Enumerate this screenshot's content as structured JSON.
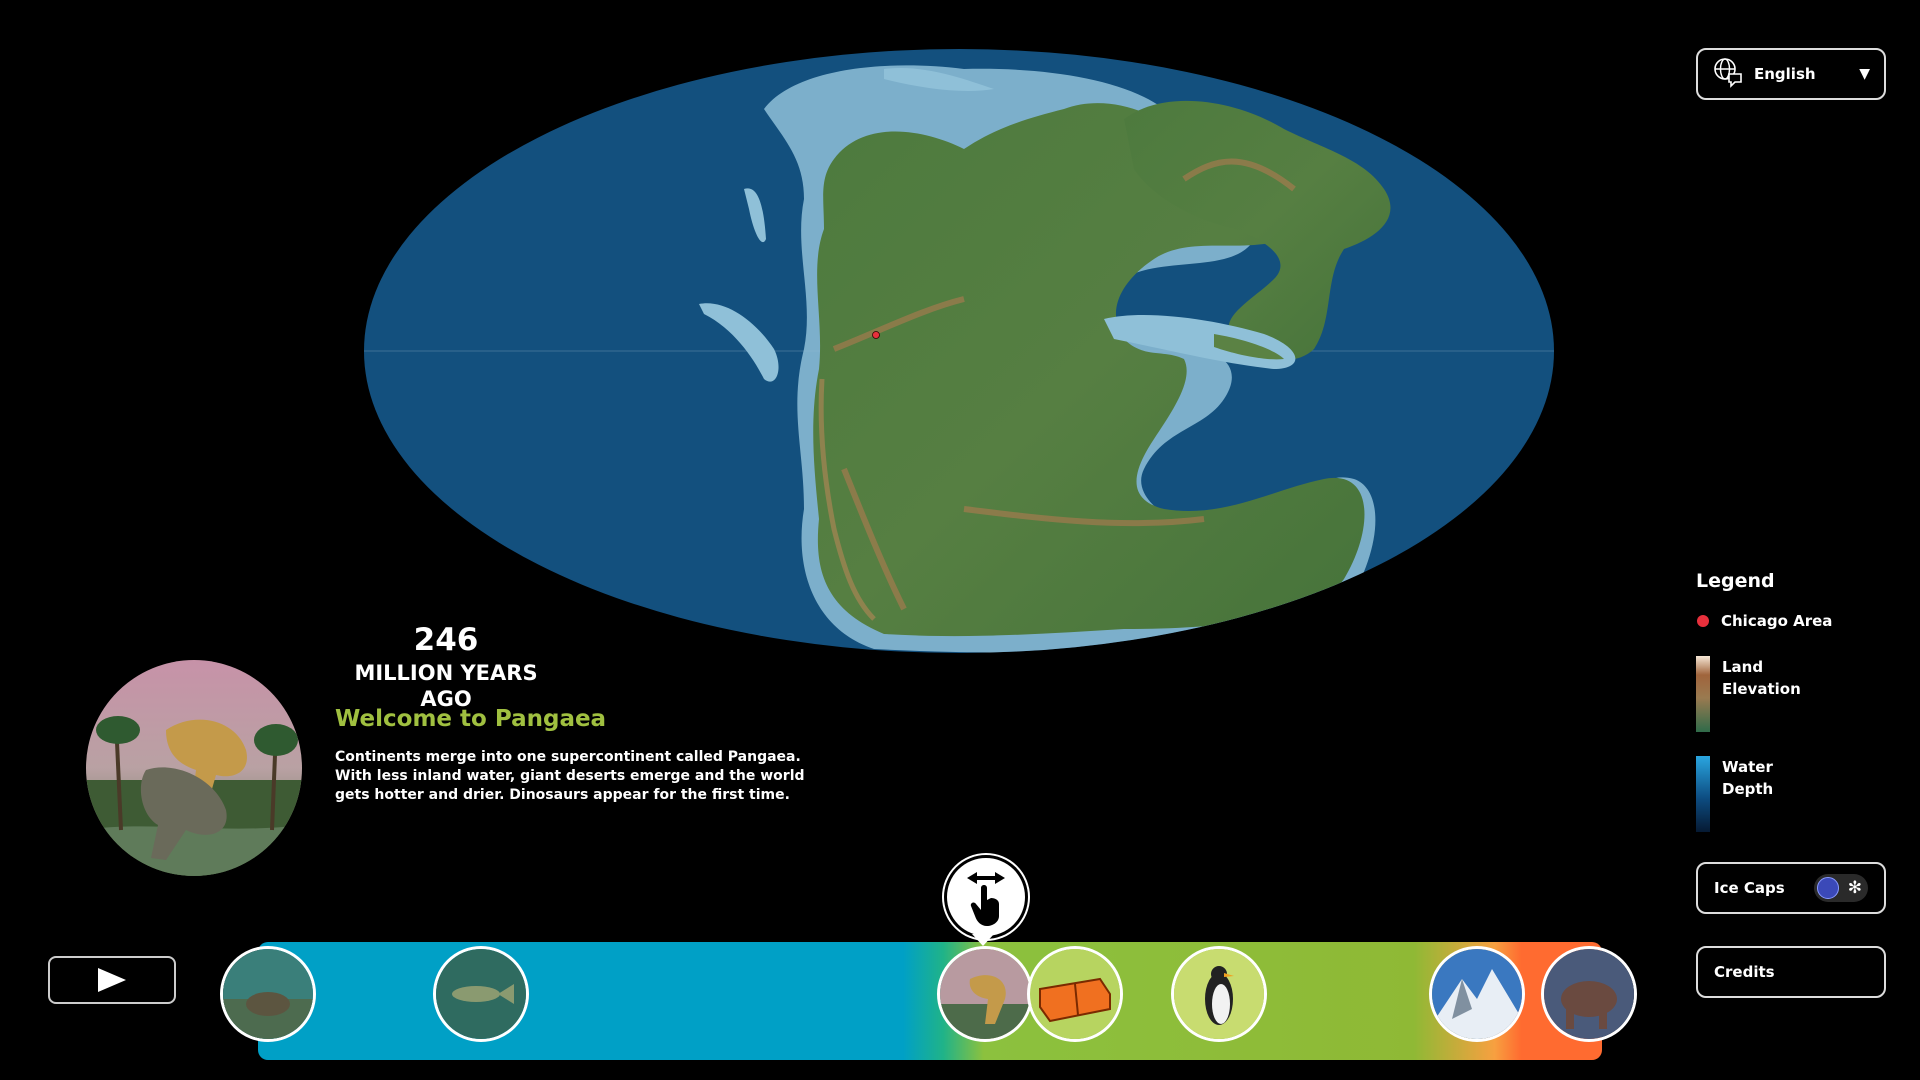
{
  "language": {
    "label": "English",
    "icon": "globe-chat-icon",
    "caret": "▼"
  },
  "legend": {
    "title": "Legend",
    "items": [
      {
        "label": "Chicago Area",
        "type": "dot",
        "color": "#e8303c"
      },
      {
        "label_line1": "Land",
        "label_line2": "Elevation",
        "type": "gradient"
      },
      {
        "label_line1": "Water",
        "label_line2": "Depth",
        "type": "gradient"
      }
    ]
  },
  "ice_caps": {
    "label": "Ice Caps",
    "on": false,
    "icon": "snowflake-icon",
    "glyph": "✻"
  },
  "credits": {
    "label": "Credits"
  },
  "era": {
    "years": "246",
    "unit": "MILLION YEARS AGO",
    "title": "Welcome to Pangaea",
    "description": "Continents merge into one supercontinent called Pangaea. With less inland water, giant deserts emerge and the world gets hotter and drier. Dinosaurs appear for the first time.",
    "image": "dinosaurs-illustration"
  },
  "play": {
    "icon": "play-icon"
  },
  "timeline": {
    "thumbnails": [
      "ancient-sea-creature",
      "fossil-fish",
      "dinosaurs",
      "tectonic-block",
      "penguin",
      "snowy-mountain",
      "woolly-mammoth"
    ]
  },
  "colors": {
    "accent_green": "#a0c040",
    "ocean": "#13507e",
    "shelf": "#8fc0d8",
    "timeline_blue": "#00a0c6",
    "timeline_green": "#8fb935",
    "timeline_orange": "#ff6b30"
  }
}
